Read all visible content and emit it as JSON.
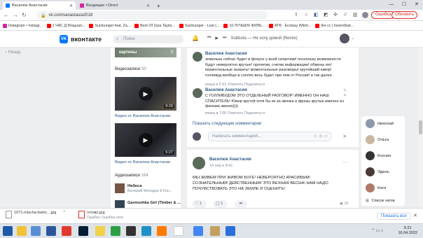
{
  "browser": {
    "tabs": [
      {
        "label": "Василюк Анастасия",
        "active": true
      },
      {
        "label": "Входящие • Direct",
        "active": false
      }
    ],
    "new_tab": "+",
    "url": "vk.com/vanastasia2018",
    "error_label": "Ошибка",
    "update_label": "Обновить",
    "bookmarks": [
      "Instagram • Instagr...",
      "1 ЧАС Д Мощная...",
      "Sunlounger feat. Za...",
      "Best Of Zara Taylor...",
      "Sunlounger - Lost (...",
      "10 ЛУЧШИХ ФИЛЬ...",
      "ATB - Ecstasy (Minh...",
      "the cc | hover(feat..."
    ]
  },
  "vk": {
    "logo": "вконтакте",
    "search_placeholder": "Поиск",
    "player_track": "Subbota — Не хочу домой (Remix)",
    "nav_back": "Назад",
    "left": {
      "photo_caption": "картины",
      "photo_count": "3",
      "videos_title": "Видеозаписи",
      "videos_count": "50",
      "video1_duration": "8:29",
      "video1_caption": "Видео от Василюк Анастасии",
      "video2_duration": "5:27",
      "video2_caption": "Видео от Василюк Анастасии",
      "audio_title": "Аудиозаписи",
      "audio_count": "164",
      "audio": [
        {
          "title": "Небеса",
          "artist": "Валерий Меладзе & Кон..."
        },
        {
          "title": "Garmoshka Girl (Timber & ...",
          "artist": ""
        }
      ]
    },
    "comments": [
      {
        "author": "Василюк Анастасия",
        "text": "земелька сейчас будет в фокусе у всей галактики! поскольку возможности будут невероятно крутые! прочитки, считки информации! обмены ею! моментальные захваты! моментальные разговоры! крутейший юмор! голливуд вообще в соплях весь будет при чем от России! и так далее",
        "meta": "вчера в 5:53   Ответить   Поделиться"
      },
      {
        "author": "Василюк Анастасия",
        "text": "С ГОЛЛИВУДОМ ЭТО ОТДЕЛЬНЫЙ РАЗГОВОР! ИМЕННО ОН НАШ СПАСИТЕЛЬ! Юмор крутой хотя бы из за звонка и фразы крутые именно из фильма звонок))))",
        "meta": "вчера в 7:06   Ответить   Поделиться"
      }
    ],
    "show_more": "Показать следующие комментарии",
    "comment_placeholder": "Написать комментарий...",
    "post": {
      "author": "Василюк Анастасия",
      "date": "14 апр в 8:41",
      "text": "МЫ ЖИВЕМ ПРИ ЖИВОМ БОГЕ! НЕВЕРОЯТНО КРАСИВЫМ! СОЗНАТЕЛЬНЫМ! ДЕВСТВЕННЫМ! ЭТО ВЕЧНАЯ ВЕСНА! НАМ НАДО ПОЧУВСТВОВАТЬ ЭТО НА ЗЕМЛЕ И ОЦЕНИТЬ!",
      "likes": "1",
      "comments": "1",
      "views": "15"
    },
    "friends": [
      "Николай",
      "Ольга",
      "Ксения",
      "Эдель",
      "Катя"
    ],
    "friends_more": "Список чатов"
  },
  "downloads": [
    {
      "name": "1071-mischa-barto....jpg",
      "status": ""
    },
    {
      "name": "готово.jpg",
      "status": "Ошибка: Ошибка сети"
    }
  ],
  "downloads_show_all": "Показать все",
  "clock": {
    "time": "5:21",
    "date": "16.04.2022"
  }
}
